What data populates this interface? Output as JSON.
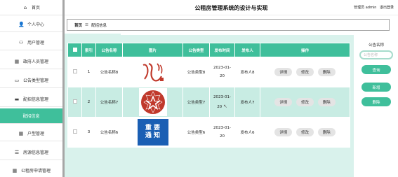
{
  "sidebar": {
    "items": [
      {
        "label": "首页",
        "icon": "home-icon",
        "glyph": "⌂"
      },
      {
        "label": "个人中心",
        "icon": "person-icon",
        "glyph": "👤"
      },
      {
        "label": "用户管理",
        "icon": "people-icon",
        "glyph": "⚇"
      },
      {
        "label": "政府人员管理",
        "icon": "grid-icon",
        "glyph": "▦"
      },
      {
        "label": "公告类型管理",
        "icon": "monitor-icon",
        "glyph": "▭"
      },
      {
        "label": "配招信息管理",
        "icon": "card-icon",
        "glyph": "▬"
      },
      {
        "label": "配招信息",
        "icon": "",
        "glyph": ""
      },
      {
        "label": "户型管理",
        "icon": "grid-icon",
        "glyph": "▦"
      },
      {
        "label": "房源信息管理",
        "icon": "sliders-icon",
        "glyph": "☰"
      },
      {
        "label": "公租房申请管理",
        "icon": "grid-icon",
        "glyph": "▦"
      }
    ],
    "active_index": 6
  },
  "header": {
    "title": "公租房管理系统的设计与实现",
    "user_text": "管理员 admin",
    "logout": "退出登录"
  },
  "breadcrumb": {
    "home": "首页",
    "sep": "☰",
    "current": "配招信息"
  },
  "table": {
    "columns": [
      "索引",
      "公告名称",
      "图片",
      "公告类型",
      "发布时间",
      "发布人",
      "操作"
    ],
    "rows": [
      {
        "index": "1",
        "name": "公告名称8",
        "type": "公告类型8",
        "date": "2023-01-",
        "date2": "20",
        "publisher": "发布人8",
        "image": "calligraphy"
      },
      {
        "index": "2",
        "name": "公告名称7",
        "type": "公告类型7",
        "date": "2023-01-",
        "date2": "20",
        "publisher": "发布人7",
        "image": "star-emblem"
      },
      {
        "index": "3",
        "name": "公告名称6",
        "type": "公告类型6",
        "date": "2023-01-",
        "date2": "20",
        "publisher": "发布人6",
        "image": "notice"
      }
    ],
    "actions": {
      "detail": "详情",
      "edit": "修改",
      "delete": "删除"
    },
    "notice_image_text": [
      "重 要",
      "通 知"
    ]
  },
  "search_panel": {
    "label": "公告名称",
    "placeholder": "公告名称",
    "search_button": "查询",
    "add_button": "新增",
    "delete_button": "删除"
  },
  "colors": {
    "accent": "#3fbf9b",
    "row_highlight": "#c8ece3",
    "table_bg": "#d9f2ec"
  }
}
